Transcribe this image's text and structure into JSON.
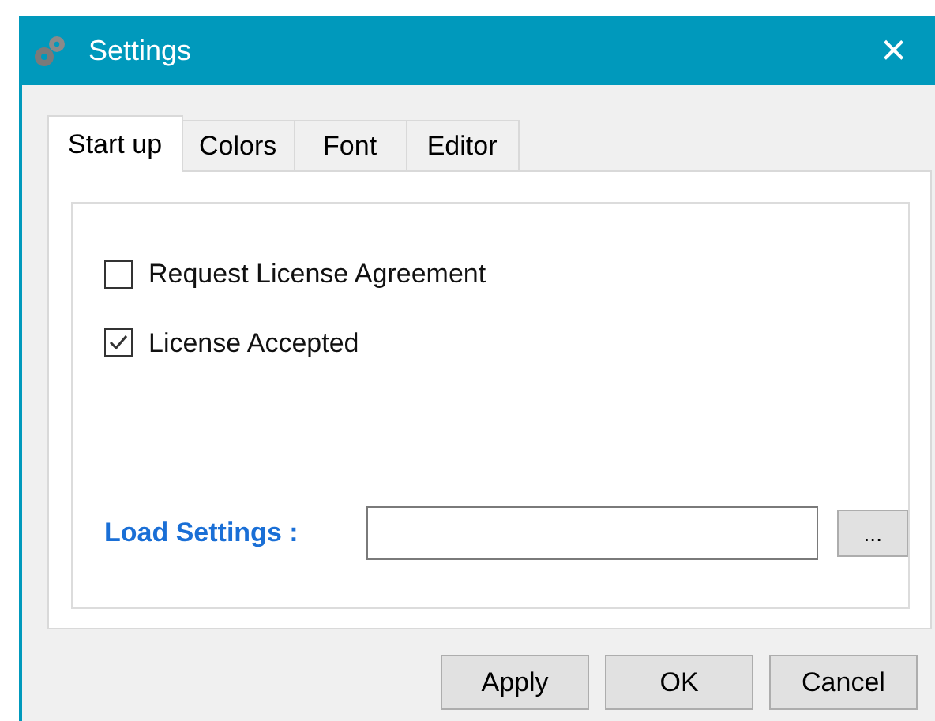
{
  "window": {
    "title": "Settings",
    "close": "×"
  },
  "tabs": [
    {
      "label": "Start up",
      "selected": true
    },
    {
      "label": "Colors",
      "selected": false
    },
    {
      "label": "Font",
      "selected": false
    },
    {
      "label": "Editor",
      "selected": false
    }
  ],
  "options": [
    {
      "label": "Request License Agreement",
      "checked": false
    },
    {
      "label": "License Accepted",
      "checked": true
    }
  ],
  "load_settings": {
    "label": "Load Settings :",
    "browse": "..."
  },
  "buttons": [
    "Apply",
    "OK",
    "Cancel"
  ]
}
